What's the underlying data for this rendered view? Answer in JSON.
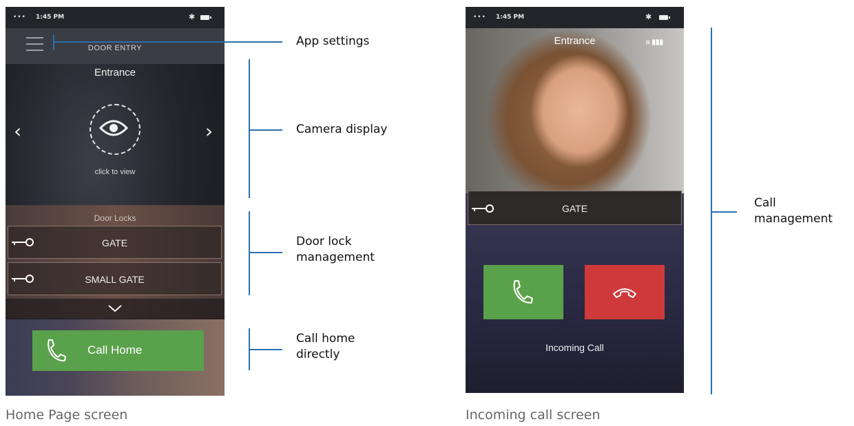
{
  "status_bar": {
    "signal": "•••",
    "time": "1:45 PM"
  },
  "home_screen": {
    "top_bar_title": "DOOR ENTRY",
    "camera_title": "Entrance",
    "click_to_view": "click to view",
    "door_locks_title": "Door Locks",
    "locks": [
      {
        "label": "GATE"
      },
      {
        "label": "SMALL GATE"
      }
    ],
    "call_home_label": "Call Home"
  },
  "incoming_screen": {
    "camera_title": "Entrance",
    "lock_label": "GATE",
    "incoming_label": "Incoming Call"
  },
  "annotations": {
    "app_settings": "App settings",
    "camera_display": "Camera display",
    "door_lock_line1": "Door lock",
    "door_lock_line2": "management",
    "call_home_line1": "Call home",
    "call_home_line2": "directly",
    "call_mgmt_line1": "Call",
    "call_mgmt_line2": "management"
  },
  "captions": {
    "home": "Home Page screen",
    "incoming": "Incoming call screen"
  },
  "colors": {
    "accept_green": "#5aa14c",
    "reject_red": "#d0393a",
    "annotation_blue": "#2a6fb0"
  }
}
